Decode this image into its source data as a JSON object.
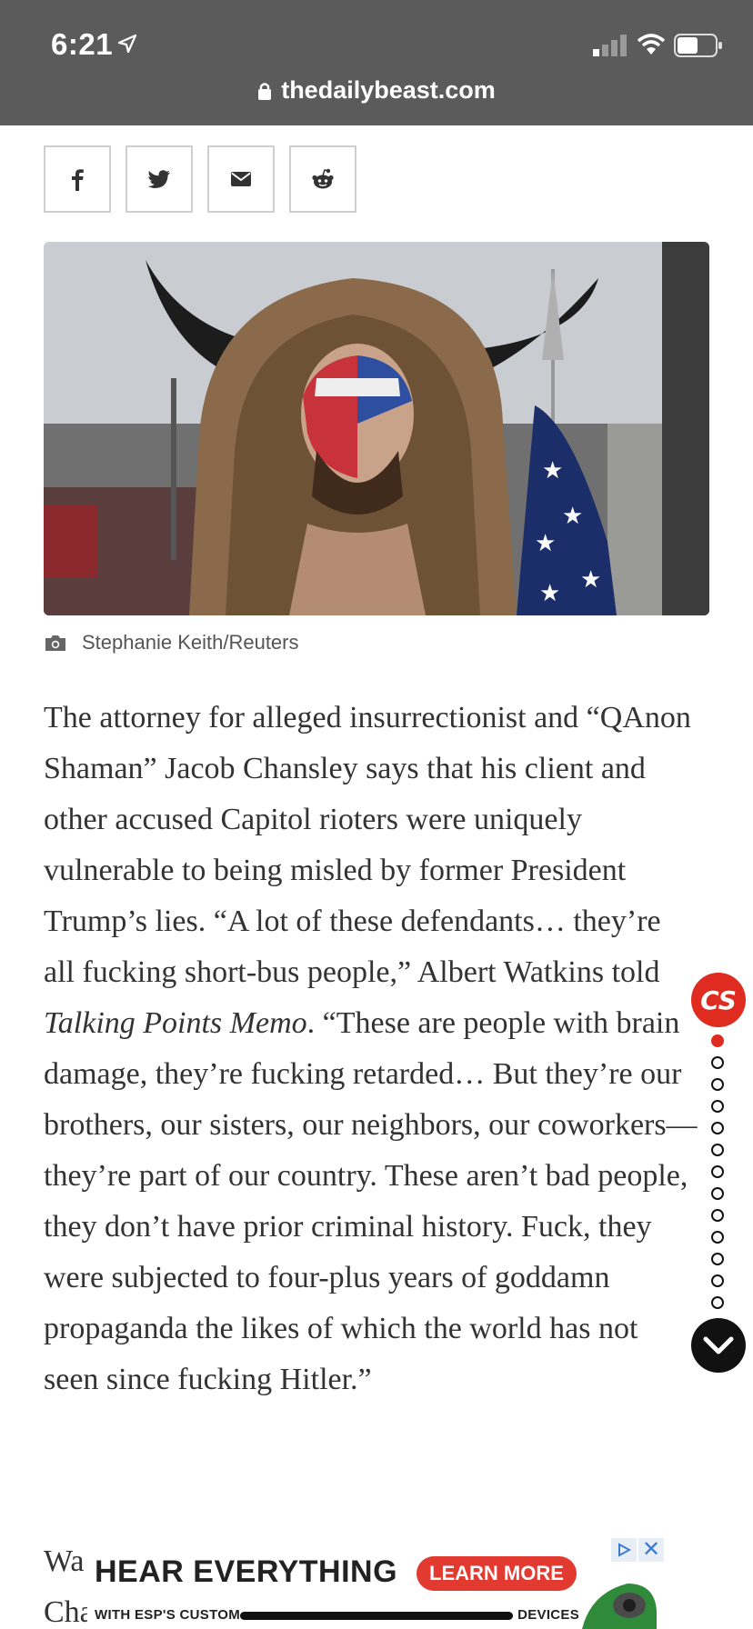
{
  "status_bar": {
    "time": "6:21"
  },
  "browser": {
    "url": "thedailybeast.com"
  },
  "share": {
    "buttons": [
      "facebook-icon",
      "twitter-icon",
      "email-icon",
      "reddit-icon"
    ]
  },
  "photo": {
    "credit": "Stephanie Keith/Reuters"
  },
  "article": {
    "p1_a": "The attorney for alleged insurrectionist and “QAnon Shaman” Jacob Chansley says that his client and other accused Capitol rioters were uniquely vulnerable to being misled by former President Trump’s lies. “A lot of these defendants… they’re all fucking short-bus people,” Albert Watkins told ",
    "p1_em": "Talking Points Memo",
    "p1_b": ". “These are people with brain damage, they’re fucking retarded… But they’re our brothers, our sisters, our neighbors, our coworkers—they’re part of our country. These aren’t bad people, they don’t have prior criminal history. Fuck, they were subjected to four-plus years of goddamn propaganda the likes of which the world has not seen since fucking Hitler.”",
    "p2_line1": "Wa",
    "p2_line2": "Cha"
  },
  "progress_rail": {
    "logo": "CS",
    "dot_count": 13,
    "active_index": 0
  },
  "ad": {
    "headline": "HEAR EVERYTHING",
    "cta": "LEARN MORE",
    "subline_start": "WITH ESP'S CUSTOM",
    "subline_end": "DEVICES",
    "close": "✕"
  },
  "colors": {
    "topbar": "#5b5b5b",
    "accent": "#e02b20",
    "text": "#333333"
  }
}
